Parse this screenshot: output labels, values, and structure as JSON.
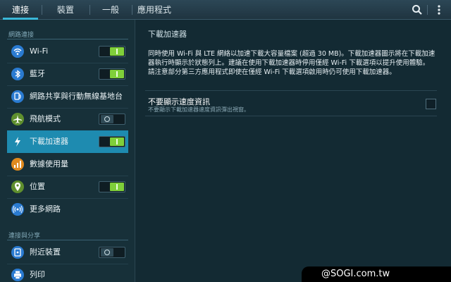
{
  "tabs": [
    {
      "label": "連接",
      "active": true
    },
    {
      "label": "裝置",
      "active": false
    },
    {
      "label": "一般",
      "active": false
    },
    {
      "label": "應用程式",
      "active": false
    }
  ],
  "toolbar": {
    "search_icon": "search-icon",
    "menu_icon": "overflow-menu-icon"
  },
  "sidebar": {
    "section1_label": "網路連接",
    "section2_label": "連接與分享",
    "items": [
      {
        "label": "Wi-Fi",
        "icon": "wifi-icon",
        "icon_color": "#2a7bd1",
        "toggle": "on"
      },
      {
        "label": "藍牙",
        "icon": "bluetooth-icon",
        "icon_color": "#2a7bd1",
        "toggle": "on"
      },
      {
        "label": "網路共享與行動無線基地台",
        "icon": "tethering-icon",
        "icon_color": "#2a7bd1",
        "toggle": "none"
      },
      {
        "label": "飛航模式",
        "icon": "airplane-icon",
        "icon_color": "#5f8f2e",
        "toggle": "off"
      },
      {
        "label": "下載加速器",
        "icon": "bolt-icon",
        "icon_color": "#1e8bb0",
        "toggle": "on",
        "selected": true
      },
      {
        "label": "數據使用量",
        "icon": "chart-icon",
        "icon_color": "#e08a1e",
        "toggle": "none"
      },
      {
        "label": "位置",
        "icon": "location-icon",
        "icon_color": "#5f8f2e",
        "toggle": "on"
      },
      {
        "label": "更多網路",
        "icon": "more-networks-icon",
        "icon_color": "#2a7bd1",
        "toggle": "none"
      },
      {
        "label": "附近裝置",
        "icon": "nearby-devices-icon",
        "icon_color": "#2a7bd1",
        "toggle": "off"
      },
      {
        "label": "列印",
        "icon": "print-icon",
        "icon_color": "#2a7bd1",
        "toggle": "none"
      }
    ]
  },
  "main": {
    "title": "下載加速器",
    "description": "同時使用 Wi-Fi 與 LTE 網絡以加速下載大容量檔案 (超過 30 MB)。下載加速器圖示將在下載加速器執行時顯示於狀態列上。建議在使用下載加速器時停用僅經 Wi-Fi 下載選項以提升使用體驗。請注意部分第三方應用程式即使在僅經 Wi-Fi 下載選項啟用時仍可使用下載加速器。",
    "option_title": "不要顯示速度資訊",
    "option_subtitle": "不要顯示下載加速器速度資訊彈出視窗。",
    "option_checked": false
  },
  "watermark": "@SOGI.com.tw"
}
